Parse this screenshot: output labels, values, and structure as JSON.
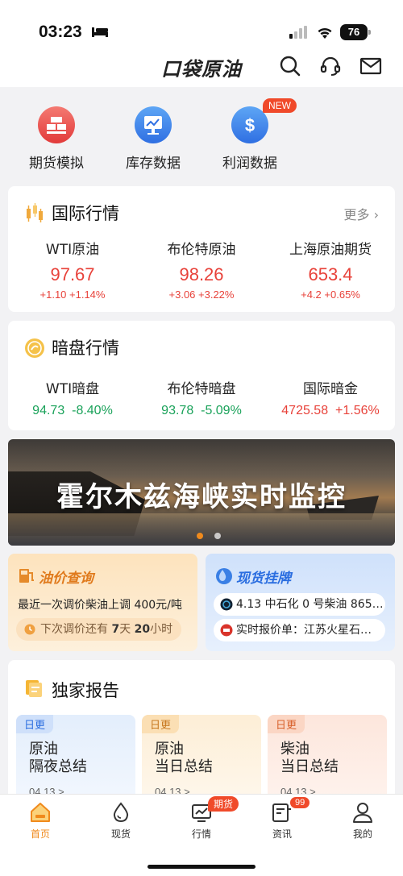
{
  "status_bar": {
    "time": "03:23",
    "battery": "76"
  },
  "header": {
    "logo": "口袋原油"
  },
  "tools": [
    {
      "label": "期货模拟",
      "color": "#e84a4a"
    },
    {
      "label": "库存数据",
      "color": "#2f7fe8"
    },
    {
      "label": "利润数据",
      "color": "#2f7fe8",
      "badge": "NEW"
    }
  ],
  "intl": {
    "title": "国际行情",
    "more": "更多",
    "quotes": [
      {
        "name": "WTI原油",
        "price": "97.67",
        "change": "+1.10 +1.14%"
      },
      {
        "name": "布伦特原油",
        "price": "98.26",
        "change": "+3.06 +3.22%"
      },
      {
        "name": "上海原油期货",
        "price": "653.4",
        "change": "+4.2 +0.65%"
      }
    ]
  },
  "dark": {
    "title": "暗盘行情",
    "quotes": [
      {
        "name": "WTI暗盘",
        "price": "94.73",
        "change": "-8.40%"
      },
      {
        "name": "布伦特暗盘",
        "price": "93.78",
        "change": "-5.09%"
      },
      {
        "name": "国际暗金",
        "price": "4725.58",
        "change": "+1.56%"
      }
    ]
  },
  "banner": {
    "title": "霍尔木兹海峡实时监控"
  },
  "oil_query": {
    "title": "油价查询",
    "desc": "最近一次调价柴油上调 400元/吨",
    "next_prefix": "下次调价还有",
    "days": "7",
    "days_unit": "天",
    "hours": "20",
    "hours_unit": "小时"
  },
  "spot": {
    "title": "现货挂牌",
    "item1": "4.13 中石化 0 号柴油 865…",
    "item2": "实时报价单：江苏火星石…"
  },
  "report": {
    "title": "独家报告",
    "cards": [
      {
        "tag": "日更",
        "line1": "原油",
        "line2": "隔夜总结",
        "date": "04.13 >"
      },
      {
        "tag": "日更",
        "line1": "原油",
        "line2": "当日总结",
        "date": "04.13 >"
      },
      {
        "tag": "日更",
        "line1": "柴油",
        "line2": "当日总结",
        "date": "04.13 >"
      }
    ]
  },
  "tabbar": {
    "tabs": [
      {
        "label": "首页"
      },
      {
        "label": "现货"
      },
      {
        "label": "行情",
        "badge": "期货"
      },
      {
        "label": "资讯",
        "badge": "99"
      },
      {
        "label": "我的"
      }
    ]
  }
}
